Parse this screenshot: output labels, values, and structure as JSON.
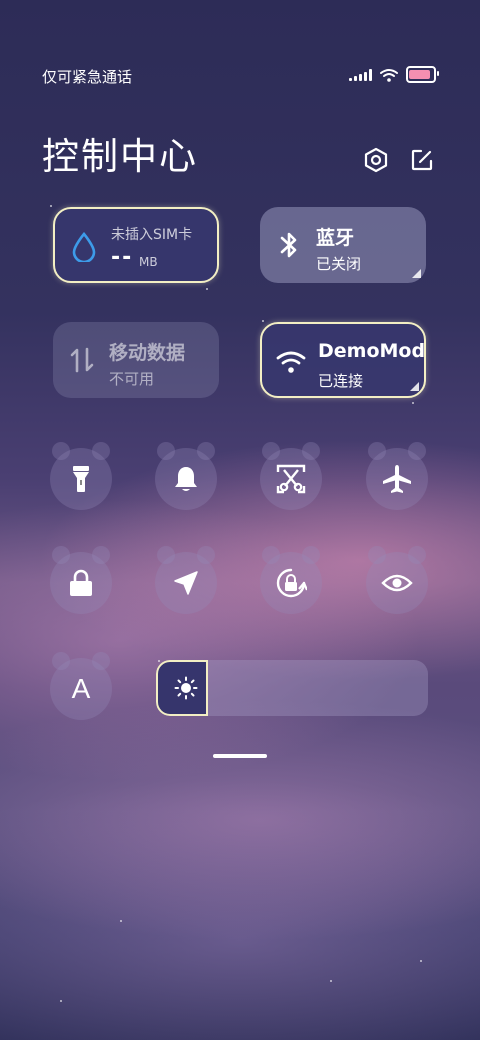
{
  "status_bar": {
    "carrier_text": "仅可紧急通话",
    "battery_level": 0.95
  },
  "header": {
    "title": "控制中心",
    "settings_icon": "settings-hexagon-icon",
    "edit_icon": "edit-icon"
  },
  "tiles": {
    "data_usage": {
      "title": "未插入SIM卡",
      "value": "--",
      "unit": "MB",
      "icon": "water-drop-icon"
    },
    "bluetooth": {
      "title": "蓝牙",
      "status": "已关闭",
      "icon": "bluetooth-icon"
    },
    "mobile_data": {
      "title": "移动数据",
      "status": "不可用",
      "icon": "data-arrows-icon"
    },
    "wifi": {
      "title": "DemoMode",
      "status": "已连接",
      "icon": "wifi-icon"
    }
  },
  "toggles": [
    {
      "name": "flashlight",
      "icon": "flashlight-icon"
    },
    {
      "name": "ringtone",
      "icon": "bell-icon"
    },
    {
      "name": "screenshot",
      "icon": "scissors-icon"
    },
    {
      "name": "airplane-mode",
      "icon": "airplane-icon"
    },
    {
      "name": "lock-screen",
      "icon": "lock-icon"
    },
    {
      "name": "location",
      "icon": "location-arrow-icon"
    },
    {
      "name": "rotation-lock",
      "icon": "rotation-lock-icon"
    },
    {
      "name": "reading-mode",
      "icon": "eye-icon"
    },
    {
      "name": "auto-brightness",
      "icon": "letter-a-icon",
      "label": "A"
    }
  ],
  "brightness": {
    "level": 0.19,
    "icon": "sun-icon"
  },
  "colors": {
    "accent_drop": "#3d9be9",
    "active_border": "#f3efc4",
    "battery_fill": "#f48fb1"
  }
}
